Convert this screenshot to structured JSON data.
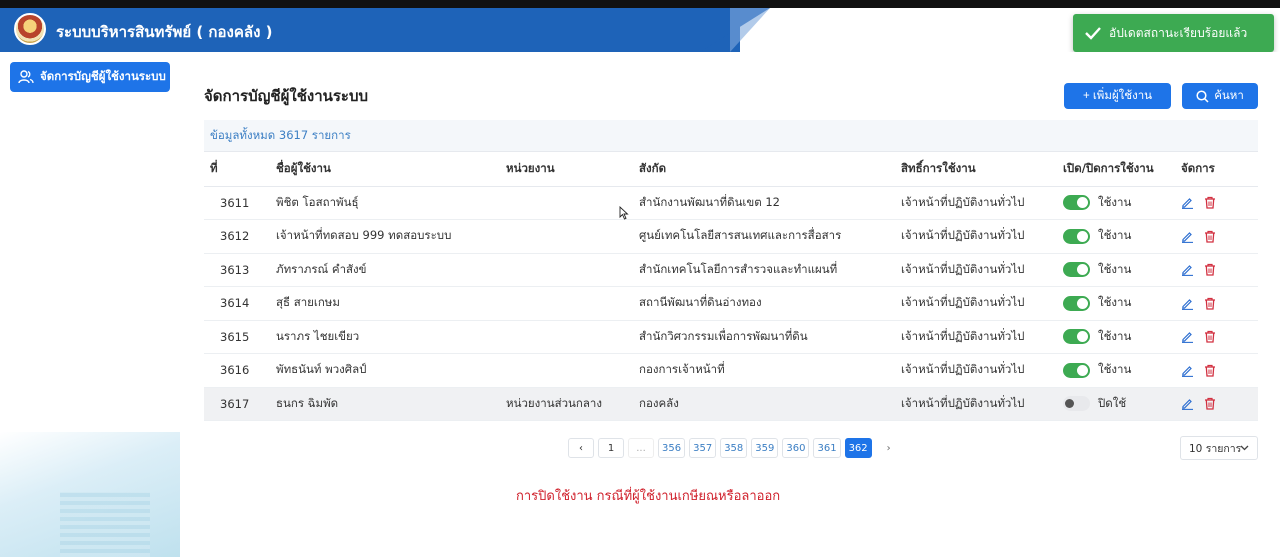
{
  "header": {
    "title": "ระบบบริหารสินทรัพย์ ( กองคลัง )"
  },
  "toast": {
    "message": "อัปเดตสถานะเรียบร้อยแล้ว"
  },
  "sidebar": {
    "menu_label": "จัดการบัญชีผู้ใช้งานระบบ"
  },
  "main": {
    "title": "จัดการบัญชีผู้ใช้งานระบบ",
    "add_label": "+ เพิ่มผู้ใช้งาน",
    "search_label": "ค้นหา",
    "total_text": "ข้อมูลทั้งหมด 3617 รายการ"
  },
  "table": {
    "columns": [
      "ที่",
      "ชื่อผู้ใช้งาน",
      "หน่วยงาน",
      "สังกัด",
      "สิทธิ์การใช้งาน",
      "เปิด/ปิดการใช้งาน",
      "จัดการ"
    ],
    "rows": [
      {
        "no": "3611",
        "name": "พิชิต โอสถาพันธุ์",
        "unit": "",
        "affiliation": "สำนักงานพัฒนาที่ดินเขต 12",
        "role": "เจ้าหน้าที่ปฏิบัติงานทั่วไป",
        "active": true,
        "status": "ใช้งาน"
      },
      {
        "no": "3612",
        "name": "เจ้าหน้าที่ทดสอบ 999 ทดสอบระบบ",
        "unit": "",
        "affiliation": "ศูนย์เทคโนโลยีสารสนเทศและการสื่อสาร",
        "role": "เจ้าหน้าที่ปฏิบัติงานทั่วไป",
        "active": true,
        "status": "ใช้งาน"
      },
      {
        "no": "3613",
        "name": "ภัทราภรณ์ คำสังข์",
        "unit": "",
        "affiliation": "สำนักเทคโนโลยีการสำรวจและทำแผนที่",
        "role": "เจ้าหน้าที่ปฏิบัติงานทั่วไป",
        "active": true,
        "status": "ใช้งาน"
      },
      {
        "no": "3614",
        "name": "สุธี สายเกษม",
        "unit": "",
        "affiliation": "สถานีพัฒนาที่ดินอ่างทอง",
        "role": "เจ้าหน้าที่ปฏิบัติงานทั่วไป",
        "active": true,
        "status": "ใช้งาน"
      },
      {
        "no": "3615",
        "name": "นราภร ไชยเขียว",
        "unit": "",
        "affiliation": "สำนักวิศวกรรมเพื่อการพัฒนาที่ดิน",
        "role": "เจ้าหน้าที่ปฏิบัติงานทั่วไป",
        "active": true,
        "status": "ใช้งาน"
      },
      {
        "no": "3616",
        "name": "พัทธนันท์ พวงศิลป์",
        "unit": "",
        "affiliation": "กองการเจ้าหน้าที่",
        "role": "เจ้าหน้าที่ปฏิบัติงานทั่วไป",
        "active": true,
        "status": "ใช้งาน"
      },
      {
        "no": "3617",
        "name": "ธนกร ฉิมพัด",
        "unit": "หน่วยงานส่วนกลาง",
        "affiliation": "กองคลัง",
        "role": "เจ้าหน้าที่ปฏิบัติงานทั่วไป",
        "active": false,
        "status": "ปิดใช้"
      }
    ]
  },
  "pagination": {
    "prev": "‹",
    "first": "1",
    "gap": "...",
    "pages": [
      "356",
      "357",
      "358",
      "359",
      "360",
      "361"
    ],
    "current": "362",
    "next": "›",
    "per_page": "10 รายการ"
  },
  "note": "การปิดใช้งาน กรณีที่ผู้ใช้งานเกษียณหรือลาออก",
  "colors": {
    "primary": "#1e74e8",
    "header": "#1e63b8",
    "success": "#3daa52",
    "danger": "#d0212c"
  }
}
